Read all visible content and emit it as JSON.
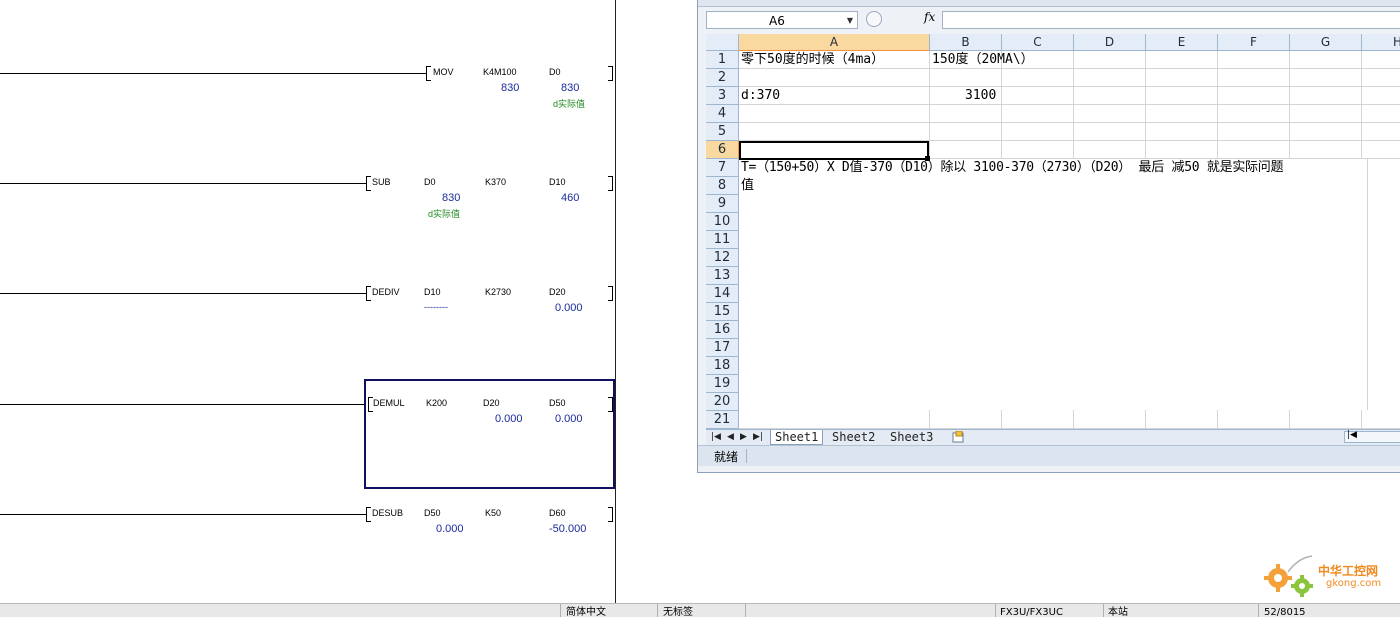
{
  "ladder": {
    "rungs": [
      {
        "instr": "MOV",
        "op1": "K4M100",
        "op1_val": "830",
        "op1_cmt": "",
        "op2": "D0",
        "op2_val": "830",
        "op2_cmt": "d实际值",
        "op3": "",
        "op3_val": ""
      },
      {
        "instr": "SUB",
        "op1": "D0",
        "op1_val": "830",
        "op1_cmt": "d实际值",
        "op2": "K370",
        "op2_val": "",
        "op2_cmt": "",
        "op3": "D10",
        "op3_val": "460"
      },
      {
        "instr": "DEDIV",
        "op1": "D10",
        "op1_val": "--------",
        "op1_cmt": "",
        "op2": "K2730",
        "op2_val": "",
        "op2_cmt": "",
        "op3": "D20",
        "op3_val": "0.000"
      },
      {
        "instr": "DEMUL",
        "op1": "K200",
        "op1_val": "",
        "op1_cmt": "",
        "op2": "D20",
        "op2_val": "0.000",
        "op2_cmt": "",
        "op3": "D50",
        "op3_val": "0.000"
      },
      {
        "instr": "DESUB",
        "op1": "D50",
        "op1_val": "0.000",
        "op1_cmt": "",
        "op2": "K50",
        "op2_val": "",
        "op2_cmt": "",
        "op3": "D60",
        "op3_val": "-50.000"
      }
    ]
  },
  "excel": {
    "name_box": "A6",
    "fx_label": "fx",
    "columns": [
      "A",
      "B",
      "C",
      "D",
      "E",
      "F",
      "G",
      "H"
    ],
    "rows": [
      "1",
      "2",
      "3",
      "4",
      "5",
      "6",
      "7",
      "8",
      "9",
      "10",
      "11",
      "12",
      "13",
      "14",
      "15",
      "16",
      "17",
      "18",
      "19",
      "20",
      "21"
    ],
    "selected_column": "A",
    "selected_row": "6",
    "cells": {
      "A1": "零下50度的时候（4ma）",
      "B1": "150度（20MA\\）",
      "A3": "d:370",
      "B3": "3100",
      "A7": "T=（150+50）X  D值-370（D10）除以 3100-370（2730）（D20）  最后 减50 就是实际问题",
      "A8": "值"
    },
    "sheet_tabs": [
      "Sheet1",
      "Sheet2",
      "Sheet3"
    ],
    "active_sheet": "Sheet1",
    "status": "就绪"
  },
  "statusbar": {
    "segments": [
      "简体中文",
      "无标签",
      "FX3U/FX3UC",
      "本站",
      "52/8015"
    ]
  },
  "watermark": {
    "text_cn": "中华工控网",
    "text_en": "gkong.com"
  },
  "colors": {
    "value_blue": "#1a2a9a",
    "comment_green": "#1f8a1f",
    "selection_navy": "#101060",
    "header_selected": "#f9d99f"
  }
}
